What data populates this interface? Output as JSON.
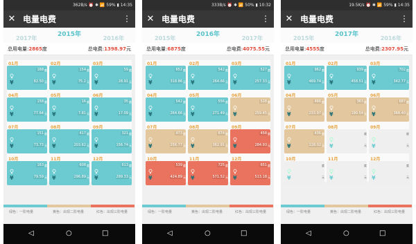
{
  "colors": {
    "green": "#6ccbd0",
    "yellow": "#e3c79e",
    "red": "#e9735e",
    "empty": "#efefef",
    "header": "#373737",
    "status": "#2e2e2e",
    "accent": "#57c2ca"
  },
  "app": {
    "title": "电量电费",
    "close_icon": "close-icon",
    "menu_icon": "more-vert-icon"
  },
  "labels": {
    "total_power": "总用电量:",
    "total_cost": "总电费:",
    "unit_kwh": "度",
    "unit_yuan": "元",
    "currency": "¥"
  },
  "legend": {
    "green": "绿色：一阶电量",
    "yellow": "黄色：出现二阶电量",
    "red": "红色：出现三阶电量"
  },
  "nav": {
    "back": "◁",
    "home": "○",
    "recent": "□"
  },
  "screens": [
    {
      "status": "362B/s  ⏰ ✱ 📶 59% ▮ 14:35",
      "years": {
        "left": "2017年",
        "center": "2015年",
        "right": "2016年"
      },
      "total_power": "2865",
      "power_unit": "度",
      "total_cost": "1398.97",
      "cost_unit": "元",
      "months": [
        {
          "label": "01月",
          "kwh": "168",
          "money": "82.50",
          "level": "green"
        },
        {
          "label": "02月",
          "kwh": "154",
          "money": "75.2",
          "level": "green"
        },
        {
          "label": "03月",
          "kwh": "59",
          "money": "28.91",
          "level": "green"
        },
        {
          "label": "04月",
          "kwh": "158",
          "money": "77.64",
          "level": "green"
        },
        {
          "label": "05月",
          "kwh": "16",
          "money": "7.81",
          "level": "green"
        },
        {
          "label": "06月",
          "kwh": "35",
          "money": "17.09",
          "level": "green"
        },
        {
          "label": "07月",
          "kwh": "151",
          "money": "73.73",
          "level": "green"
        },
        {
          "label": "08月",
          "kwh": "417",
          "money": "203.62",
          "level": "green"
        },
        {
          "label": "09月",
          "kwh": "321",
          "money": "156.74",
          "level": "green"
        },
        {
          "label": "10月",
          "kwh": "163",
          "money": "79.59",
          "level": "green"
        },
        {
          "label": "11月",
          "kwh": "608",
          "money": "296.89",
          "level": "green"
        },
        {
          "label": "12月",
          "kwh": "613",
          "money": "299.33",
          "level": "green"
        }
      ]
    },
    {
      "status": "333B/s  ⏰ ✱ 📶 50% ▮ 10:32",
      "years": {
        "left": "2015年",
        "center": "2016年",
        "right": "2017年"
      },
      "total_power": "6875",
      "power_unit": "度",
      "total_cost": "4075.55",
      "cost_unit": "元",
      "months": [
        {
          "label": "01月",
          "kwh": "652",
          "money": "318.86",
          "level": "green"
        },
        {
          "label": "02月",
          "kwh": "542",
          "money": "264.66",
          "level": "green"
        },
        {
          "label": "03月",
          "kwh": "527",
          "money": "257.33",
          "level": "green"
        },
        {
          "label": "04月",
          "kwh": "542",
          "money": "264.66",
          "level": "green"
        },
        {
          "label": "05月",
          "kwh": "556",
          "money": "271.49",
          "level": "green"
        },
        {
          "label": "06月",
          "kwh": "528",
          "money": "259.45",
          "level": "yellow"
        },
        {
          "label": "07月",
          "kwh": "473",
          "money": "256.77",
          "level": "yellow"
        },
        {
          "label": "08月",
          "kwh": "674",
          "money": "362.91",
          "level": "yellow"
        },
        {
          "label": "09月",
          "kwh": "458",
          "money": "284.93",
          "level": "red"
        },
        {
          "label": "10月",
          "kwh": "539",
          "money": "424.89",
          "level": "red"
        },
        {
          "label": "11月",
          "kwh": "725",
          "money": "571.52",
          "level": "red"
        },
        {
          "label": "12月",
          "kwh": "651",
          "money": "513.18",
          "level": "red"
        }
      ]
    },
    {
      "status": "19.5K/s  ⏰ ✱ 📶 59% ▮ 14:35",
      "years": {
        "left": "2015年",
        "center": "2017年",
        "right": "2016年"
      },
      "total_power": "4555",
      "power_unit": "度",
      "total_cost": "2307.95",
      "cost_unit": "元",
      "months": [
        {
          "label": "01月",
          "kwh": "962",
          "money": "469.74",
          "level": "green"
        },
        {
          "label": "02月",
          "kwh": "939",
          "money": "458.51",
          "level": "green"
        },
        {
          "label": "03月",
          "kwh": "702",
          "money": "342.77",
          "level": "green"
        },
        {
          "label": "04月",
          "kwh": "466",
          "money": "233.97",
          "level": "yellow"
        },
        {
          "label": "05月",
          "kwh": "363",
          "money": "190.54",
          "level": "yellow"
        },
        {
          "label": "06月",
          "kwh": "687",
          "money": "368.40",
          "level": "yellow"
        },
        {
          "label": "07月",
          "kwh": "436",
          "money": "228.02",
          "level": "yellow"
        },
        {
          "label": "08月",
          "kwh": "",
          "money": "",
          "level": "empty"
        },
        {
          "label": "09月",
          "kwh": "",
          "money": "",
          "level": "empty"
        },
        {
          "label": "10月",
          "kwh": "",
          "money": "",
          "level": "empty"
        },
        {
          "label": "11月",
          "kwh": "",
          "money": "",
          "level": "empty"
        },
        {
          "label": "12月",
          "kwh": "",
          "money": "",
          "level": "empty"
        }
      ]
    }
  ]
}
